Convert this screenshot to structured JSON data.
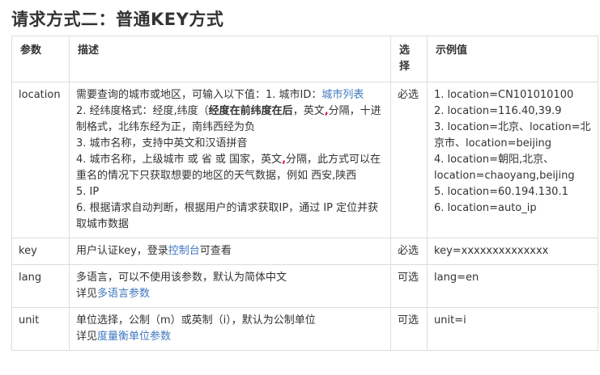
{
  "title": "请求方式二：普通KEY方式",
  "table": {
    "headers": [
      "参数",
      "描述",
      "选择",
      "示例值"
    ],
    "location": {
      "name": "location",
      "required": "必选",
      "desc": {
        "l1_text": "需要查询的城市或地区，可输入以下值：1. 城市ID：",
        "l1_link": "城市列表",
        "l2_a": "2. 经纬度格式：经度,纬度（",
        "l2_bold": "经度在前纬度在后",
        "l2_b": "，英文",
        "l2_comma": ",",
        "l2_c": "分隔，十进制格式，北纬东经为正，南纬西经为负",
        "l3": "3. 城市名称，支持中英文和汉语拼音",
        "l4_a": "4. 城市名称，上级城市 或 省 或 国家，英文",
        "l4_comma": ",",
        "l4_b": "分隔，此方式可以在重名的情况下只获取想要的地区的天气数据，例如 西安,陕西",
        "l5": "5. IP",
        "l6": "6. 根据请求自动判断，根据用户的请求获取IP，通过 IP 定位并获取城市数据"
      },
      "examples": [
        "1. location=CN101010100",
        "2. location=116.40,39.9",
        "3. location=北京、location=北京市、location=beijing",
        "4. location=朝阳,北京、location=chaoyang,beijing",
        "5. location=60.194.130.1",
        "6. location=auto_ip"
      ]
    },
    "key": {
      "name": "key",
      "required": "必选",
      "desc_a": "用户认证key，登录",
      "desc_link": "控制台",
      "desc_b": "可查看",
      "example": "key=xxxxxxxxxxxxxx"
    },
    "lang": {
      "name": "lang",
      "required": "可选",
      "desc_l1": "多语言，可以不使用该参数，默认为简体中文",
      "desc_l2": "详见",
      "desc_link": "多语言参数",
      "example": "lang=en"
    },
    "unit": {
      "name": "unit",
      "required": "可选",
      "desc_l1": "单位选择，公制（m）或英制（i），默认为公制单位",
      "desc_l2": "详见",
      "desc_link": "度量衡单位参数",
      "example": "unit=i"
    }
  },
  "colors": {
    "link": "#4078c0",
    "highlight": "#dd1144",
    "border": "#dddddd"
  }
}
